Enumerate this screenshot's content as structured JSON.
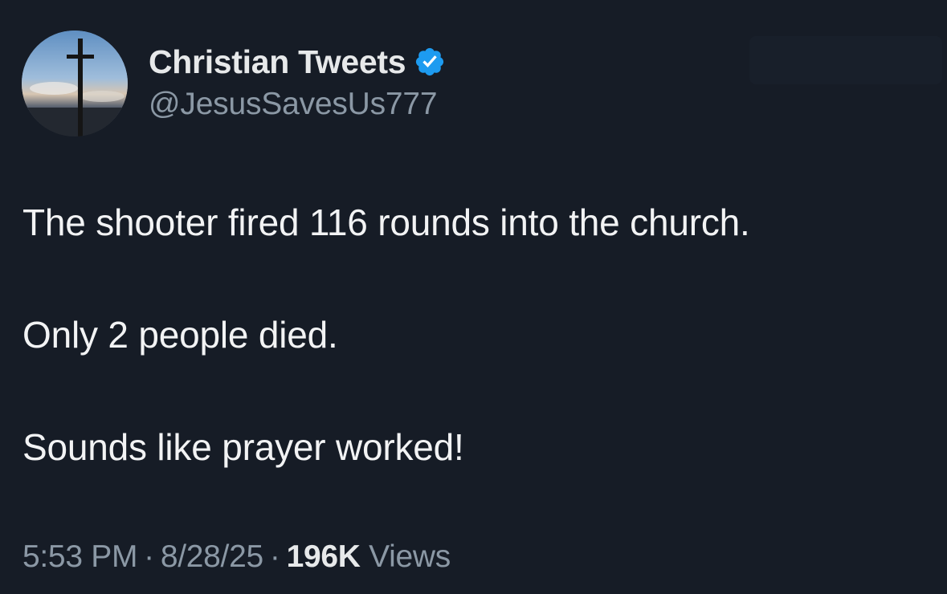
{
  "author": {
    "display_name": "Christian Tweets",
    "handle": "@JesusSavesUs777",
    "verified_icon": "verified-badge-icon",
    "avatar_icon": "cross-avatar-icon"
  },
  "tweet": {
    "lines": [
      "The shooter fired 116 rounds into the church.",
      "Only 2 people died.",
      "Sounds like prayer worked!"
    ]
  },
  "meta": {
    "time": "5:53 PM",
    "separator": "·",
    "date": "8/28/25",
    "views_count": "196K",
    "views_label": "Views"
  },
  "colors": {
    "background": "#161c26",
    "primary_text": "#e7e9ea",
    "secondary_text": "#8b98a5",
    "verified_blue": "#1d9bf0"
  }
}
